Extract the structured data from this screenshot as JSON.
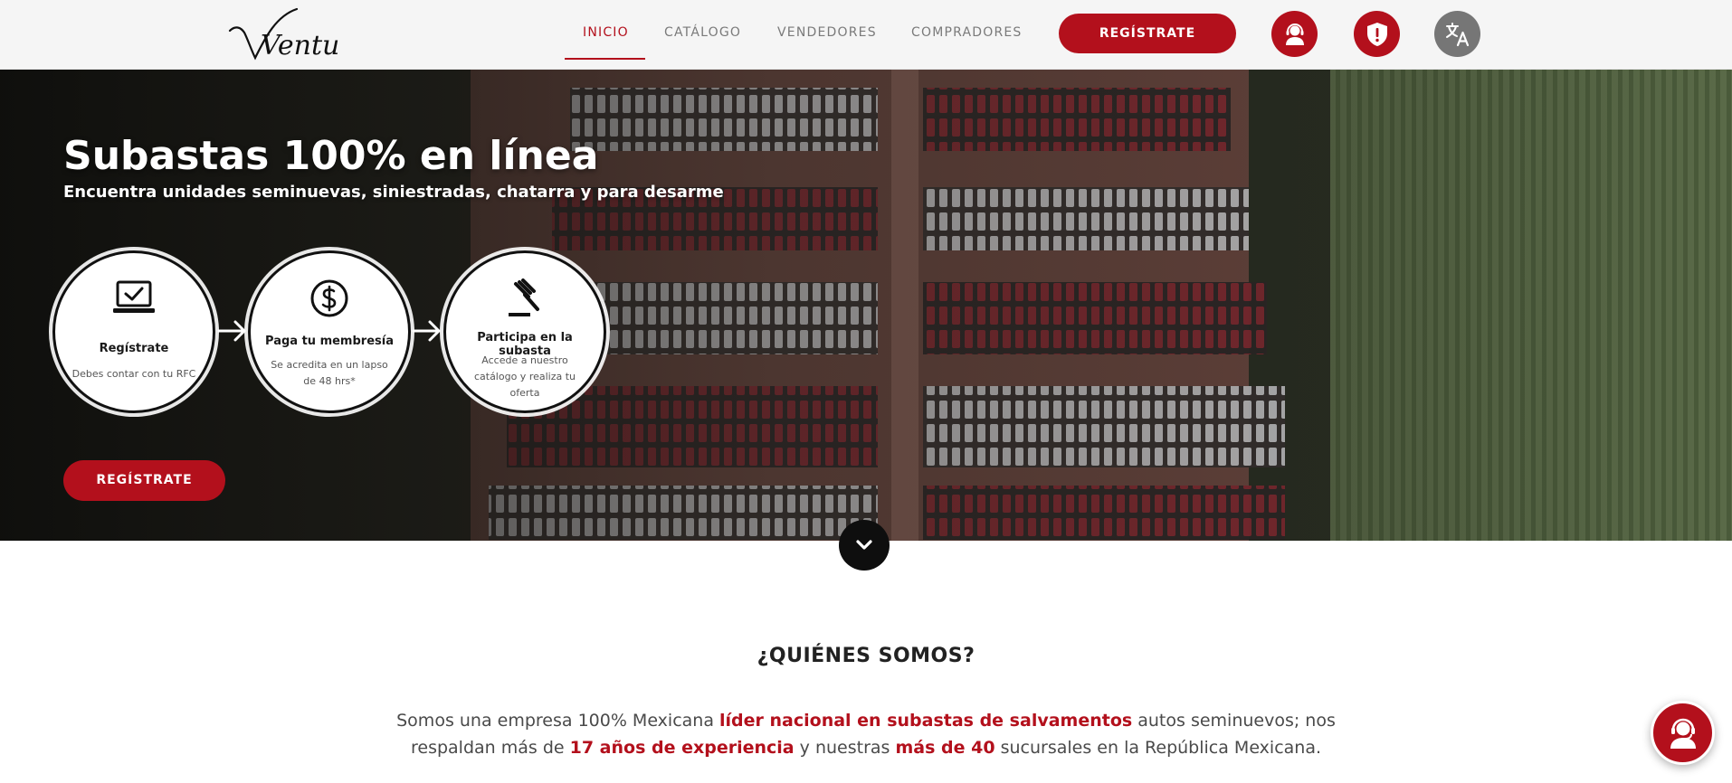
{
  "brand": {
    "logo_text": "Ventura",
    "accent_color": "#b3101c"
  },
  "nav": {
    "items": [
      {
        "label": "INICIO",
        "active": true
      },
      {
        "label": "CATÁLOGO",
        "active": false
      },
      {
        "label": "VENDEDORES",
        "active": false
      },
      {
        "label": "COMPRADORES",
        "active": false
      }
    ],
    "register_label": "REGÍSTRATE",
    "icons": [
      "support-agent-icon",
      "shield-alert-icon",
      "translate-icon"
    ]
  },
  "hero": {
    "title": "Subastas 100% en línea",
    "subtitle": "Encuentra unidades seminuevas, siniestradas, chatarra y para desarme",
    "steps": [
      {
        "icon": "laptop-check-icon",
        "title": "Regístrate",
        "desc": "Debes contar con tu RFC"
      },
      {
        "icon": "dollar-circle-icon",
        "title": "Paga tu membresía",
        "desc": "Se acredita en un lapso de 48 hrs*"
      },
      {
        "icon": "gavel-icon",
        "title": "Participa en la subasta",
        "desc": "Accede a nuestro catálogo y realiza tu oferta"
      }
    ],
    "cta_label": "REGÍSTRATE"
  },
  "about": {
    "title": "¿QUIÉNES SOMOS?",
    "text_parts": [
      {
        "text": "Somos una empresa 100% Mexicana ",
        "highlight": false
      },
      {
        "text": "líder nacional en subastas de salvamentos",
        "highlight": true
      },
      {
        "text": " autos seminuevos; nos respaldan más de ",
        "highlight": false
      },
      {
        "text": "17 años de experiencia",
        "highlight": true
      },
      {
        "text": " y nuestras ",
        "highlight": false
      },
      {
        "text": "más de 40",
        "highlight": true
      },
      {
        "text": " sucursales en la República Mexicana.",
        "highlight": false
      }
    ]
  },
  "chat": {
    "icon": "support-agent-icon"
  }
}
